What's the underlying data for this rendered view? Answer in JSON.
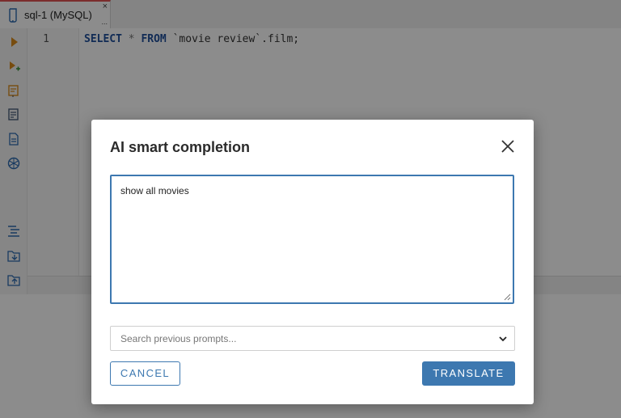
{
  "tab": {
    "label": "sql-1 (MySQL)",
    "close_glyph": "×",
    "more_glyph": "..."
  },
  "toolbar": {
    "icons": [
      "execute-icon",
      "execute-script-icon",
      "explain-plan-icon",
      "load-plan-icon",
      "export-icon",
      "ai-assistant-icon",
      "format-icon",
      "load-script-icon",
      "save-script-icon"
    ]
  },
  "editor": {
    "line_number": "1",
    "code": {
      "kw_select": "SELECT",
      "star": "*",
      "kw_from": "FROM",
      "table": "`movie review`.film;"
    }
  },
  "dialog": {
    "title": "AI smart completion",
    "prompt_value": "show all movies",
    "search_placeholder": "Search previous prompts...",
    "cancel_label": "CANCEL",
    "translate_label": "TRANSLATE"
  },
  "colors": {
    "accent": "#3d78b0",
    "keyword": "#1f4f9c",
    "tab_indicator": "#e05252"
  }
}
